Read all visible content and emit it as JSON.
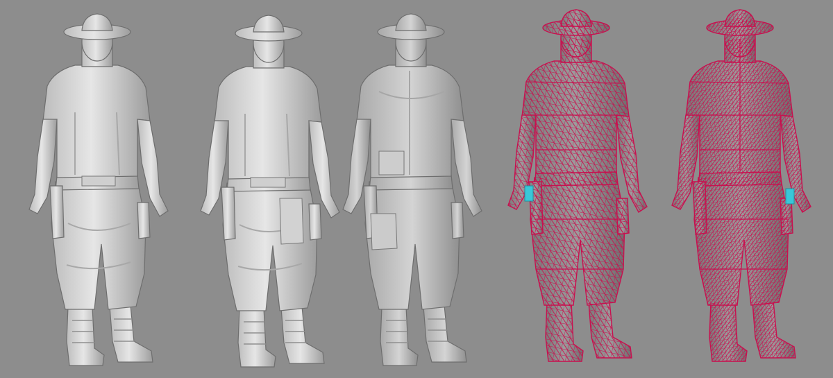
{
  "scene": {
    "background_color": "#8d8d8d",
    "clay_color": "#d9d9d9",
    "clay_shadow_color": "#9a9a9a",
    "wire_fill_color": "#8a8a8a",
    "wire_color": "#c8104f",
    "accent_color": "#39c7d8",
    "views": [
      {
        "id": "front-three-quarter",
        "style": "clay"
      },
      {
        "id": "front-quarter",
        "style": "clay"
      },
      {
        "id": "back-three-quarter",
        "style": "clay"
      },
      {
        "id": "front-wireframe",
        "style": "wireframe"
      },
      {
        "id": "back-wireframe",
        "style": "wireframe"
      }
    ]
  }
}
